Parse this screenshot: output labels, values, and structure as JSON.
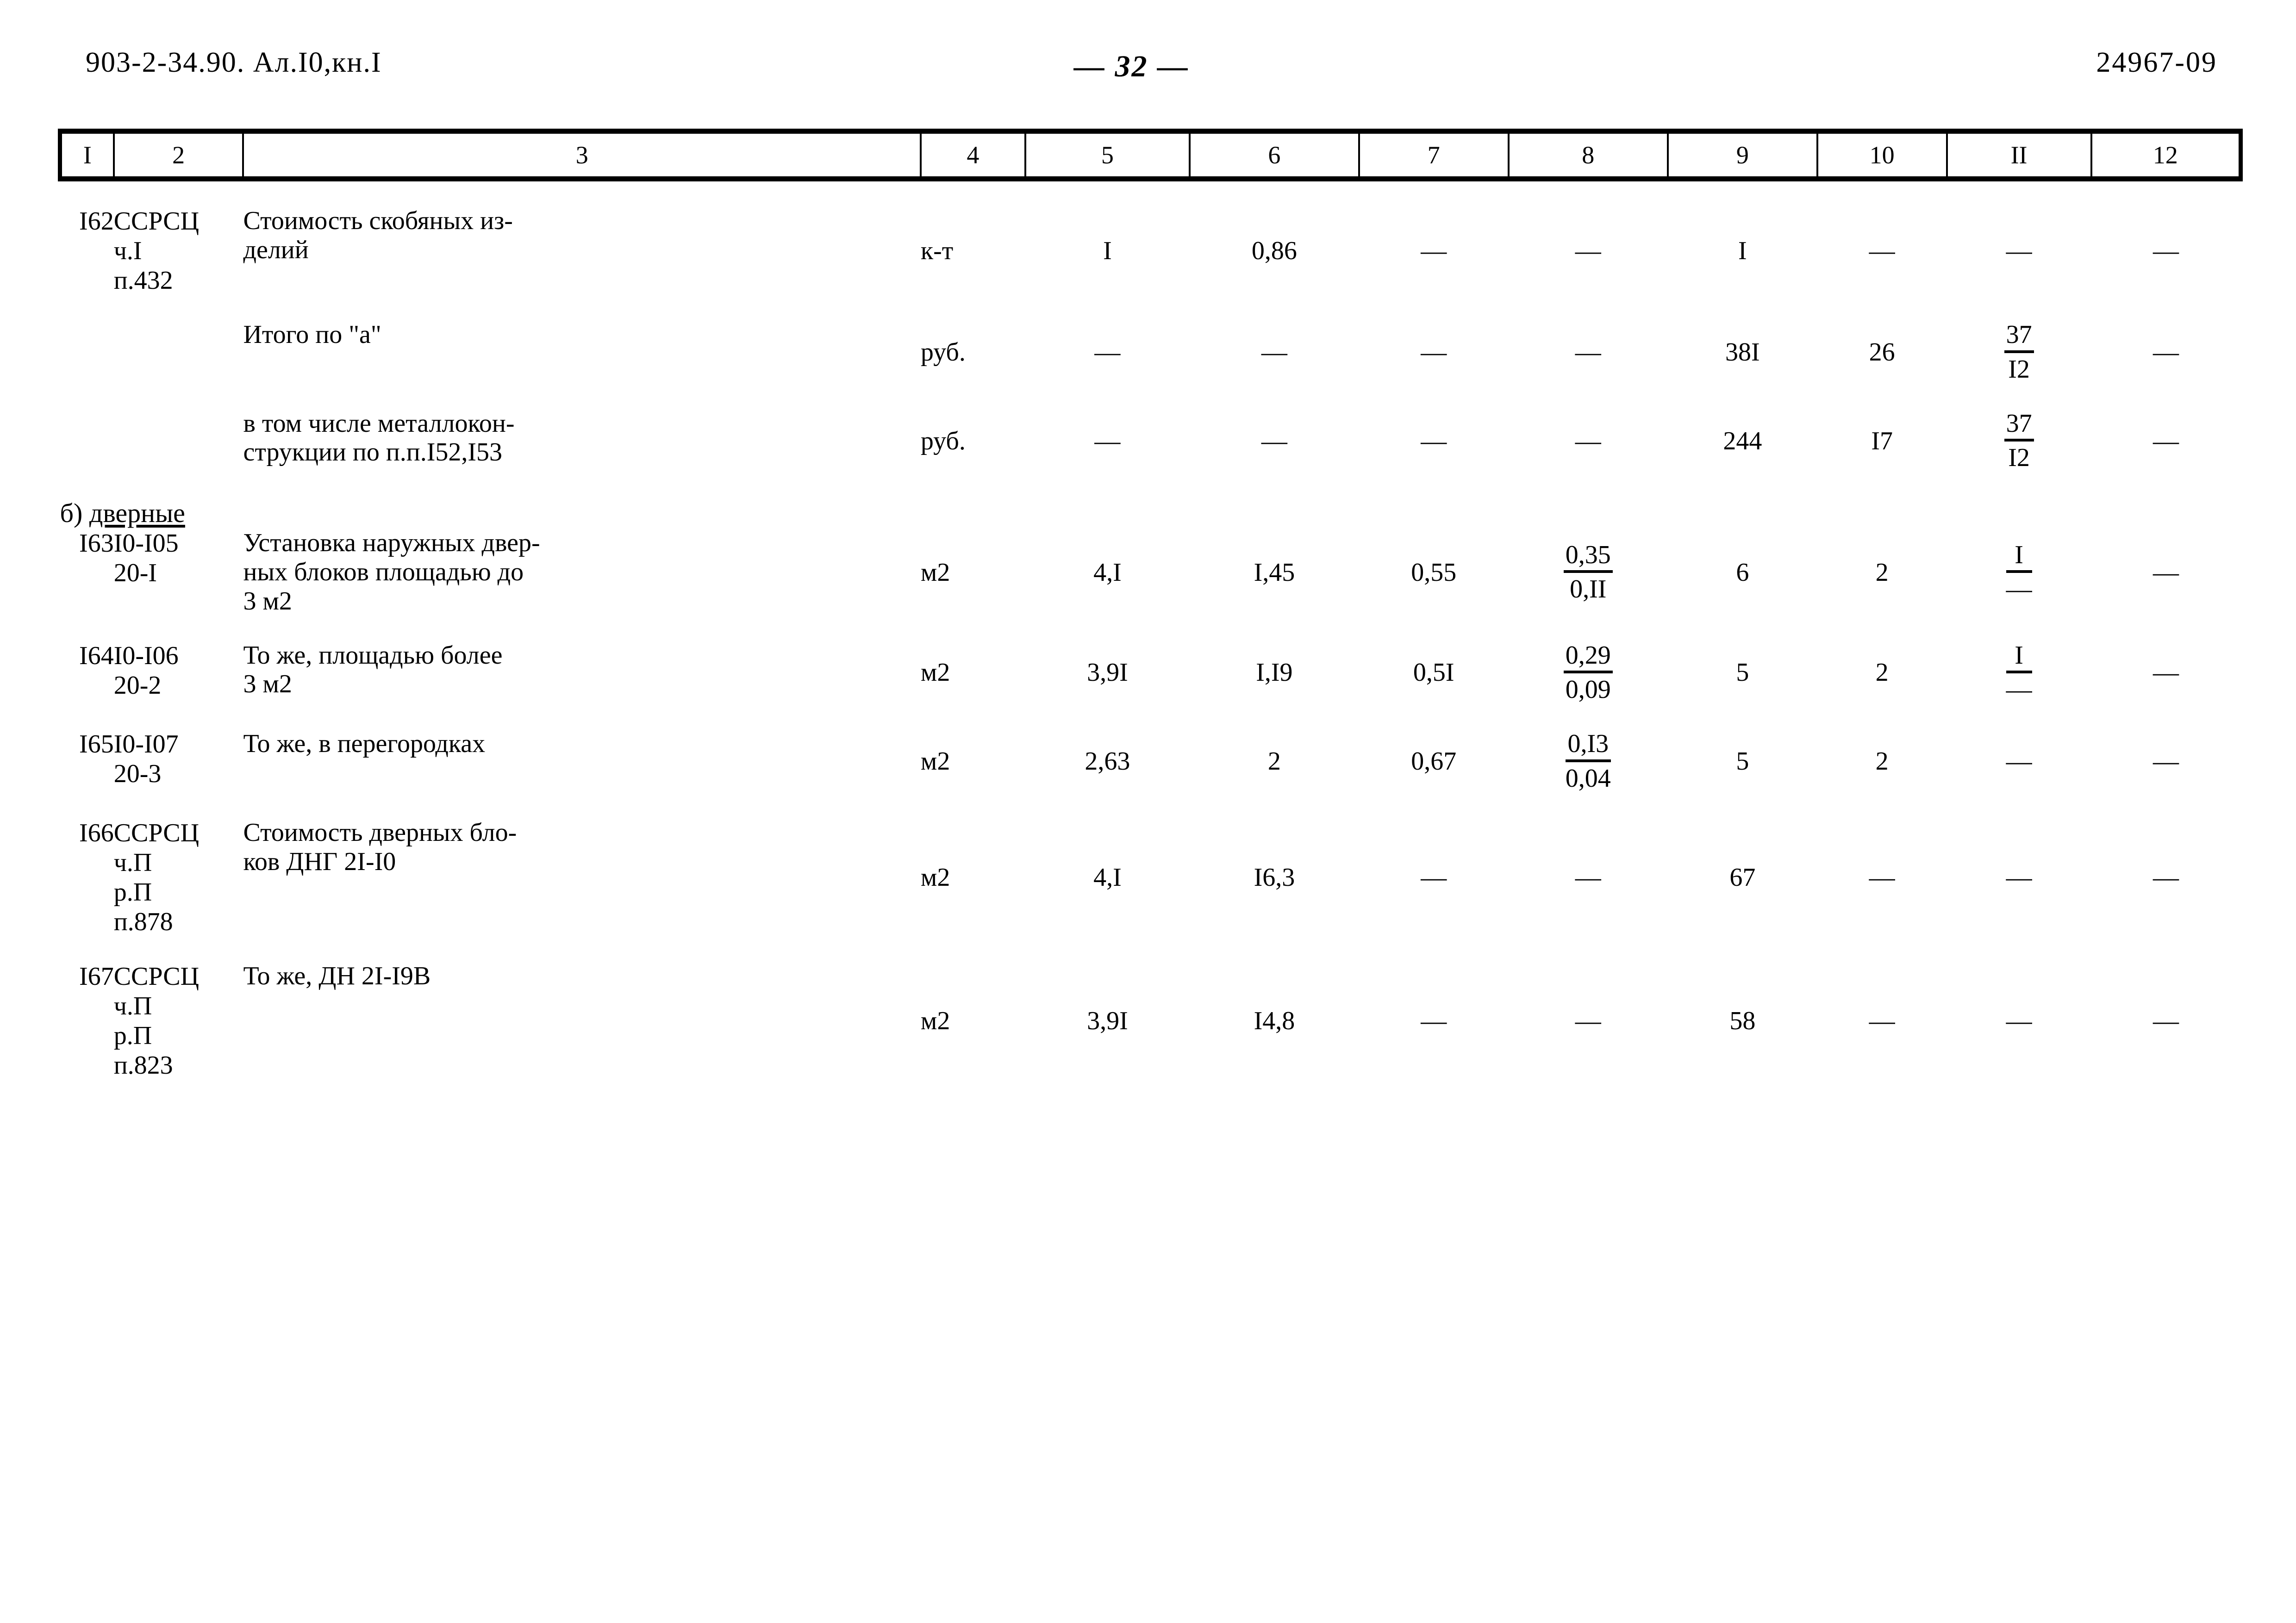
{
  "header": {
    "left": "903-2-34.90. Ал.I0,кн.I",
    "page_number": "— 32 —",
    "right": "24967-09"
  },
  "table": {
    "column_numbers": [
      "I",
      "2",
      "3",
      "4",
      "5",
      "6",
      "7",
      "8",
      "9",
      "10",
      "II",
      "12"
    ],
    "rows": [
      {
        "kind": "item",
        "num": "I62",
        "code": [
          "ССРСЦ",
          "ч.I",
          "п.432"
        ],
        "desc": [
          "Стоимость скобяных из-",
          "делий"
        ],
        "unit": "к-т",
        "c5": "I",
        "c6": "0,86",
        "c7": "—",
        "c8": "—",
        "c9": "I",
        "c10": "—",
        "c11": "—",
        "c12": "—"
      },
      {
        "kind": "total",
        "num": "",
        "code": [],
        "desc": [
          "Итого по \"а\""
        ],
        "unit": "руб.",
        "c5": "—",
        "c6": "—",
        "c7": "—",
        "c8": "—",
        "c9": "38I",
        "c10": "26",
        "c11_frac": {
          "top": "37",
          "bot": "I2"
        },
        "c12": "—"
      },
      {
        "kind": "total",
        "num": "",
        "code": [],
        "desc": [
          "в том числе металлокон-",
          "струкции по п.п.I52,I53"
        ],
        "unit": "руб.",
        "c5": "—",
        "c6": "—",
        "c7": "—",
        "c8": "—",
        "c9": "244",
        "c10": "I7",
        "c11_frac": {
          "top": "37",
          "bot": "I2"
        },
        "c12": "—"
      },
      {
        "kind": "section",
        "label_prefix": "б) ",
        "label": "дверные"
      },
      {
        "kind": "item",
        "num": "I63",
        "code": [
          "I0-I05",
          "20-I"
        ],
        "desc": [
          "Установка наружных двер-",
          "ных блоков площадью до",
          "3 м2"
        ],
        "unit": "м2",
        "c5": "4,I",
        "c6": "I,45",
        "c7": "0,55",
        "c8_frac": {
          "top": "0,35",
          "bot": "0,II"
        },
        "c9": "6",
        "c10": "2",
        "c11_frac": {
          "top": "I",
          "bot": "—"
        },
        "c12": "—"
      },
      {
        "kind": "item",
        "num": "I64",
        "code": [
          "I0-I06",
          "20-2"
        ],
        "desc": [
          "То же, площадью более",
          "3 м2"
        ],
        "unit": "м2",
        "c5": "3,9I",
        "c6": "I,I9",
        "c7": "0,5I",
        "c8_frac": {
          "top": "0,29",
          "bot": "0,09"
        },
        "c9": "5",
        "c10": "2",
        "c11_frac": {
          "top": "I",
          "bot": "—"
        },
        "c12": "—"
      },
      {
        "kind": "item",
        "num": "I65",
        "code": [
          "I0-I07",
          "20-3"
        ],
        "desc": [
          "То же, в перегородках"
        ],
        "unit": "м2",
        "c5": "2,63",
        "c6": "2",
        "c7": "0,67",
        "c8_frac": {
          "top": "0,I3",
          "bot": "0,04"
        },
        "c9": "5",
        "c10": "2",
        "c11": "—",
        "c12": "—"
      },
      {
        "kind": "item",
        "num": "I66",
        "code": [
          "ССРСЦ",
          "ч.П",
          "р.П",
          "п.878"
        ],
        "desc": [
          "Стоимость дверных бло-",
          "ков ДНГ 2I-I0"
        ],
        "unit": "м2",
        "c5": "4,I",
        "c6": "I6,3",
        "c7": "—",
        "c8": "—",
        "c9": "67",
        "c10": "—",
        "c11": "—",
        "c12": "—"
      },
      {
        "kind": "item",
        "num": "I67",
        "code": [
          "ССРСЦ",
          "ч.П",
          "р.П",
          "п.823"
        ],
        "desc": [
          "То же, ДН 2I-I9В"
        ],
        "unit": "м2",
        "c5": "3,9I",
        "c6": "I4,8",
        "c7": "—",
        "c8": "—",
        "c9": "58",
        "c10": "—",
        "c11": "—",
        "c12": "—"
      }
    ]
  }
}
